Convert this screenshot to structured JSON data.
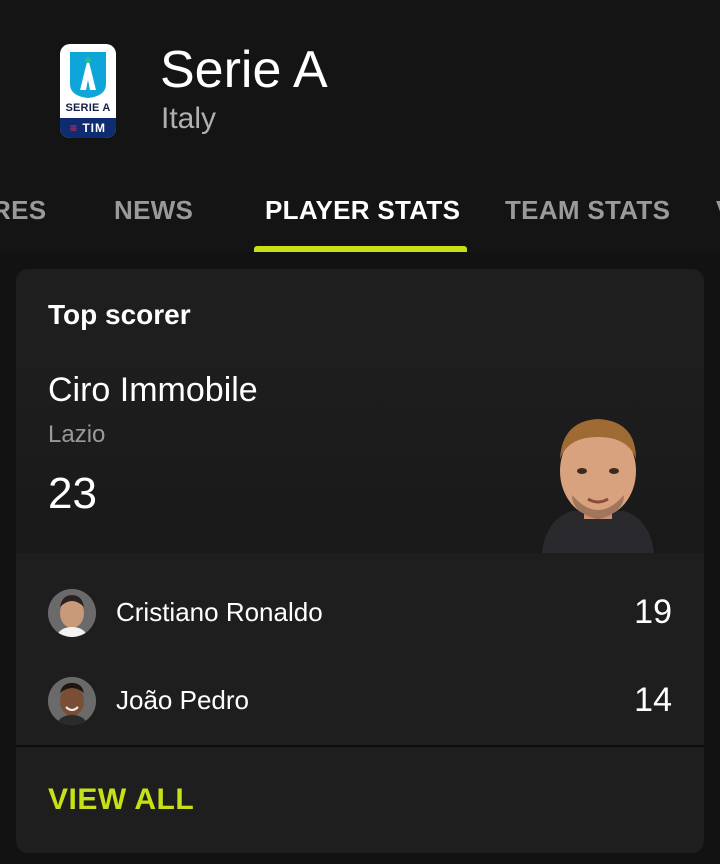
{
  "header": {
    "league_name": "Serie A",
    "country": "Italy",
    "logo": {
      "icon": "serie-a-logo-icon",
      "text": "SERIE A",
      "sponsor": "TIM",
      "colors": {
        "shield": "#0ea5d8",
        "accent": "#23c08f",
        "sponsor_bg": "#0e2c6f",
        "sponsor_accent": "#ff2a54"
      }
    }
  },
  "tabs": [
    {
      "label": "RES",
      "active": false
    },
    {
      "label": "NEWS",
      "active": false
    },
    {
      "label": "PLAYER STATS",
      "active": true
    },
    {
      "label": "TEAM STATS",
      "active": false
    },
    {
      "label": "V",
      "active": false
    }
  ],
  "top_scorer_card": {
    "title": "Top scorer",
    "leader": {
      "name": "Ciro Immobile",
      "team": "Lazio",
      "goals": "23",
      "photo_icon": "player-photo-icon"
    },
    "others": [
      {
        "name": "Cristiano Ronaldo",
        "goals": "19",
        "avatar_icon": "player-avatar-icon"
      },
      {
        "name": "João Pedro",
        "goals": "14",
        "avatar_icon": "player-avatar-icon"
      }
    ],
    "view_all_label": "VIEW ALL"
  },
  "colors": {
    "background": "#121212",
    "card": "#1e1e1e",
    "accent": "#c8e117",
    "muted_text": "#9a9a9a"
  }
}
